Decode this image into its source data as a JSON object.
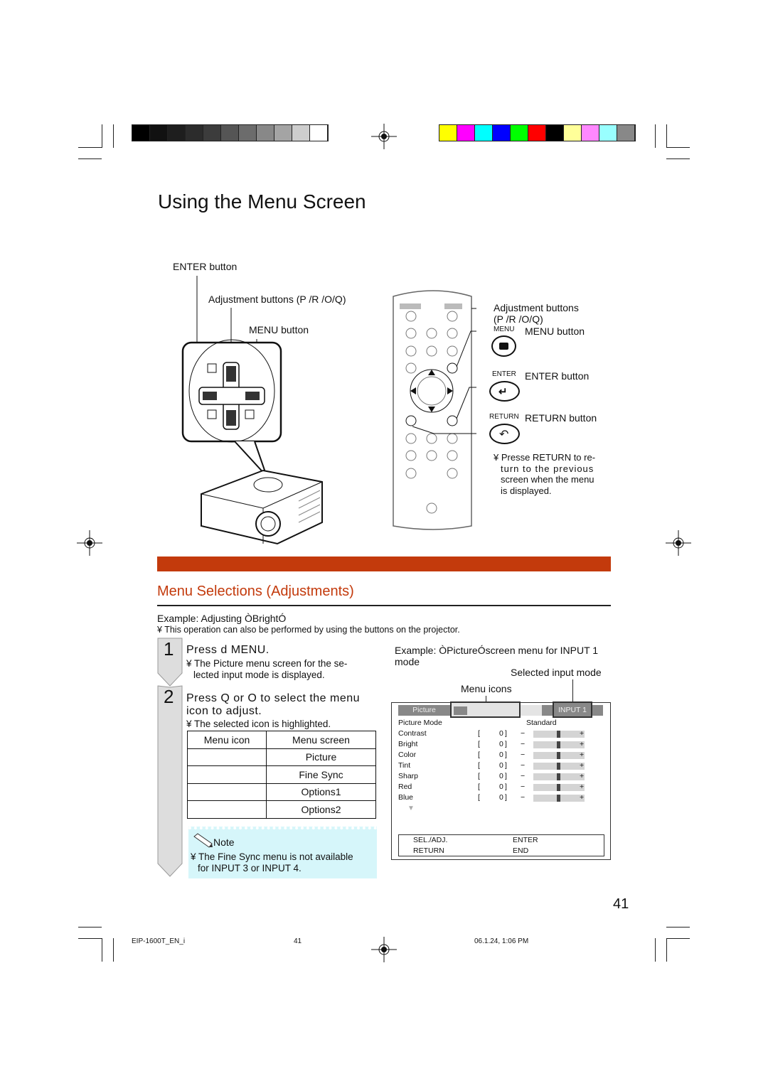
{
  "header": {
    "grayscale_bars": [
      "#000000",
      "#111111",
      "#1e1e1e",
      "#2c2c2c",
      "#3c3c3c",
      "#555555",
      "#6c6c6c",
      "#888888",
      "#a4a4a4",
      "#cdcdcd",
      "#ffffff"
    ],
    "color_bars": [
      "#ffff00",
      "#ff00ff",
      "#00ffff",
      "#0000ff",
      "#00ff00",
      "#ff0000",
      "#000000",
      "#ffff99",
      "#ff88ff",
      "#99ffff",
      "#888888"
    ]
  },
  "page_title": "Using the Menu Screen",
  "projector_diagram": {
    "enter_label": "ENTER button",
    "adjustment_label": "Adjustment buttons (P /R /O/Q)",
    "menu_label": "MENU button"
  },
  "remote_diagram": {
    "adjustment_label": "Adjustment buttons",
    "adjustment_keys": "(P /R /O/Q)",
    "menu_tag": "MENU",
    "menu_label": "MENU button",
    "enter_tag": "ENTER",
    "enter_label": "ENTER button",
    "return_tag": "RETURN",
    "return_label": "RETURN button",
    "return_note": [
      "¥ Presse   RETURN to re-",
      "turn to the previous",
      "screen when the menu",
      "is displayed."
    ]
  },
  "accent_color": "#c33a0c",
  "section": {
    "title": "Menu Selections (Adjustments)",
    "example": "Example: Adjusting ÒBrightÓ",
    "note": "¥ This operation can also be performed by using the buttons on the projector."
  },
  "steps": [
    {
      "number": "1",
      "title": "Press d  MENU.",
      "detail": [
        "¥ The  Picture  menu screen for the se-",
        "lected input mode is displayed."
      ]
    },
    {
      "number": "2",
      "title": [
        "Press  Q  or  O  to select the menu",
        "icon to adjust."
      ],
      "detail": [
        "¥ The selected icon is highlighted."
      ]
    }
  ],
  "menu_table": {
    "headers": [
      "Menu icon",
      "Menu screen"
    ],
    "rows": [
      [
        "",
        "Picture"
      ],
      [
        "",
        "Fine Sync"
      ],
      [
        "",
        "Options1"
      ],
      [
        "",
        "Options2"
      ]
    ]
  },
  "note_box": {
    "title": "Note",
    "text": [
      "¥ The  Fine Sync  menu is not available",
      "for INPUT 3 or INPUT 4."
    ]
  },
  "screen_example": {
    "caption": [
      "Example: ÒPictureÓscreen menu for INPUT 1",
      "mode"
    ],
    "selected_input_label": "Selected input mode",
    "menu_icons_label": "Menu icons",
    "tab_label": "Picture",
    "input_label": "INPUT 1",
    "picture_mode_label": "Picture Mode",
    "picture_mode_value": "Standard",
    "items": [
      {
        "name": "Contrast",
        "value": "0",
        "level": 0.5
      },
      {
        "name": "Bright",
        "value": "0",
        "level": 0.5
      },
      {
        "name": "Color",
        "value": "0",
        "level": 0.5
      },
      {
        "name": "Tint",
        "value": "0",
        "level": 0.5
      },
      {
        "name": "Sharp",
        "value": "0",
        "level": 0.5
      },
      {
        "name": "Red",
        "value": "0",
        "level": 0.5
      },
      {
        "name": "Blue",
        "value": "0",
        "level": 0.5
      }
    ],
    "guide": [
      [
        "SEL./ADJ.",
        "ENTER"
      ],
      [
        "RETURN",
        "END"
      ]
    ]
  },
  "page_number": "41",
  "footer": {
    "file": "EIP-1600T_EN_i",
    "page": "41",
    "timestamp": "06.1.24, 1:06 PM"
  }
}
